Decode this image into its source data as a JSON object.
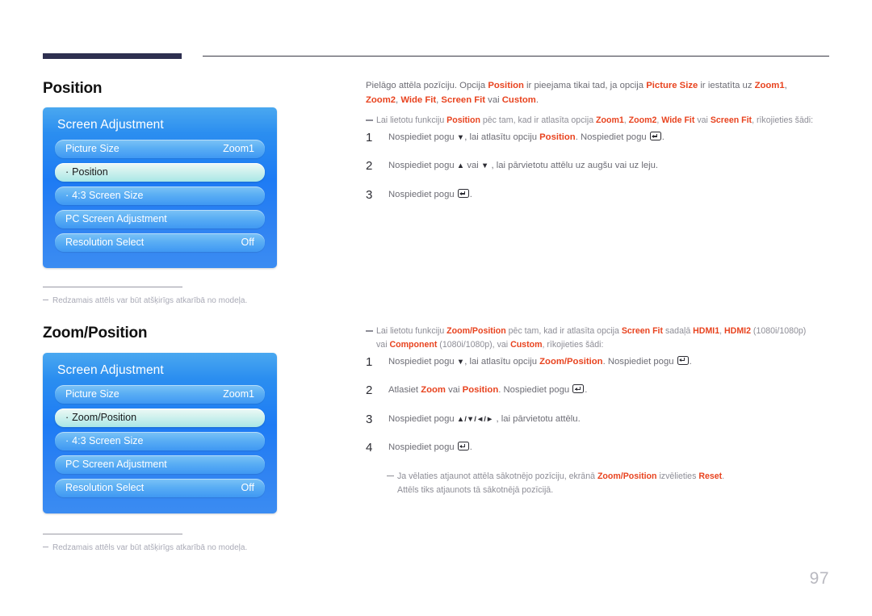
{
  "page": {
    "number": "97",
    "accent_color": "#e8431f",
    "header_bar_color": "#2e3050",
    "osd_panel_blue": "#1d7bf4",
    "osd_selected_mint": "#a9e7e6"
  },
  "sections": [
    {
      "title": "Position",
      "osd": {
        "title": "Screen Adjustment",
        "rows": [
          {
            "bullet": "",
            "label": "Picture Size",
            "value": "Zoom1",
            "selected": false
          },
          {
            "bullet": "·",
            "label": "Position",
            "value": "",
            "selected": true
          },
          {
            "bullet": "·",
            "label": "4:3 Screen Size",
            "value": "",
            "selected": false
          },
          {
            "bullet": "",
            "label": "PC Screen Adjustment",
            "value": "",
            "selected": false
          },
          {
            "bullet": "",
            "label": "Resolution Select",
            "value": "Off",
            "selected": false
          }
        ]
      },
      "caption": "Redzamais attēls var būt atšķirīgs atkarībā no modeļa.",
      "intro_paragraph": {
        "text_1": "Pielāgo attēla pozīciju. Opcija ",
        "hl_1": "Position",
        "text_2": " ir pieejama tikai tad, ja opcija ",
        "hl_2": "Picture Size",
        "text_3": " ir iestatīta uz ",
        "hl_3": "Zoom1",
        "text_4": ", ",
        "hl_4": "Zoom2",
        "text_5": ", ",
        "hl_5": "Wide Fit",
        "text_6": ", ",
        "hl_6": "Screen Fit",
        "text_7": " vai ",
        "hl_7": "Custom",
        "text_8": "."
      },
      "note": {
        "text_1": "Lai lietotu funkciju ",
        "hl_1": "Position",
        "text_2": " pēc tam, kad ir atlasīta opcija ",
        "hl_2": "Zoom1",
        "text_3": ", ",
        "hl_3": "Zoom2",
        "text_4": ", ",
        "hl_4": "Wide Fit",
        "text_5": " vai ",
        "hl_5": "Screen Fit",
        "text_6": ", rīkojieties šādi:"
      },
      "steps": [
        {
          "num": "1",
          "t1": "Nospiediet pogu ",
          "arrow": "▼",
          "t2": ", lai atlasītu opciju ",
          "hl": "Position",
          "t3": ". Nospiediet pogu ",
          "t4": "."
        },
        {
          "num": "2",
          "t1": "Nospiediet pogu ",
          "arrow": "▲",
          "t2": " vai ",
          "arrow2": "▼",
          "t3": " , lai pārvietotu attēlu uz augšu vai uz leju."
        },
        {
          "num": "3",
          "t1": "Nospiediet pogu ",
          "t4": "."
        }
      ]
    },
    {
      "title": "Zoom/Position",
      "osd": {
        "title": "Screen Adjustment",
        "rows": [
          {
            "bullet": "",
            "label": "Picture Size",
            "value": "Zoom1",
            "selected": false
          },
          {
            "bullet": "·",
            "label": "Zoom/Position",
            "value": "",
            "selected": true
          },
          {
            "bullet": "·",
            "label": "4:3 Screen Size",
            "value": "",
            "selected": false
          },
          {
            "bullet": "",
            "label": "PC Screen Adjustment",
            "value": "",
            "selected": false
          },
          {
            "bullet": "",
            "label": "Resolution Select",
            "value": "Off",
            "selected": false
          }
        ]
      },
      "caption": "Redzamais attēls var būt atšķirīgs atkarībā no modeļa.",
      "note": {
        "text_1": "Lai lietotu funkciju ",
        "hl_1": "Zoom/Position",
        "text_2": " pēc tam, kad ir atlasīta opcija ",
        "hl_2": "Screen Fit",
        "text_3": " sadaļā ",
        "hl_3": "HDMI1",
        "text_4": ", ",
        "hl_4": "HDMI2",
        "text_5": " (1080i/1080p) vai ",
        "hl_5": "Component",
        "text_6": " (1080i/1080p), vai ",
        "hl_6": "Custom",
        "text_7": ", rīkojieties šādi:"
      },
      "steps": [
        {
          "num": "1",
          "t1": "Nospiediet pogu ",
          "arrow": "▼",
          "t2": ", lai atlasītu opciju ",
          "hl": "Zoom/Position",
          "t3": ". Nospiediet pogu ",
          "t4": "."
        },
        {
          "num": "2",
          "t1": "Atlasiet ",
          "hl": "Zoom",
          "t2": " vai ",
          "hl2": "Position",
          "t3": ". Nospiediet pogu ",
          "t4": "."
        },
        {
          "num": "3",
          "t1": "Nospiediet pogu  ",
          "arrows": "▲/▼/◄/►",
          "t2": " , lai pārvietotu attēlu."
        },
        {
          "num": "4",
          "t1": "Nospiediet pogu ",
          "t4": "."
        }
      ],
      "final_note": {
        "text_1": "Ja vēlaties atjaunot attēla sākotnējo pozīciju, ekrānā ",
        "hl_1": "Zoom/Position",
        "text_2": " izvēlieties ",
        "hl_2": "Reset",
        "text_3": ".",
        "line_2": "Attēls tiks atjaunots tā sākotnējā pozīcijā."
      }
    }
  ]
}
